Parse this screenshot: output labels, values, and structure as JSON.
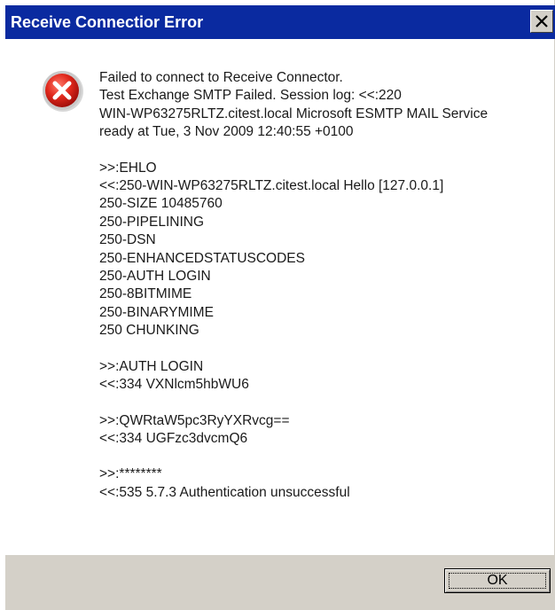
{
  "window": {
    "title": "Receive Connectior Error"
  },
  "icons": {
    "error": "error-x-circle-icon",
    "close": "close-icon"
  },
  "message": {
    "group1": [
      "Failed to connect to Receive Connector.",
      "Test Exchange SMTP Failed. Session log: <<:220",
      "WIN-WP63275RLTZ.citest.local Microsoft ESMTP MAIL Service",
      "ready at Tue, 3 Nov 2009 12:40:55 +0100"
    ],
    "group2": [
      ">>:EHLO",
      "<<:250-WIN-WP63275RLTZ.citest.local Hello [127.0.0.1]",
      "250-SIZE 10485760",
      "250-PIPELINING",
      "250-DSN",
      "250-ENHANCEDSTATUSCODES",
      "250-AUTH LOGIN",
      "250-8BITMIME",
      "250-BINARYMIME",
      "250 CHUNKING"
    ],
    "group3": [
      ">>:AUTH LOGIN",
      "<<:334 VXNlcm5hbWU6"
    ],
    "group4": [
      ">>:QWRtaW5pc3RyYXRvcg==",
      "<<:334 UGFzc3dvcmQ6"
    ],
    "group5": [
      ">>:********",
      "<<:535 5.7.3 Authentication unsuccessful"
    ]
  },
  "buttons": {
    "ok_label": "OK"
  },
  "colors": {
    "titlebar": "#0a2aa0",
    "error_red": "#d7261e",
    "dialog_gray": "#d4d0c8"
  }
}
